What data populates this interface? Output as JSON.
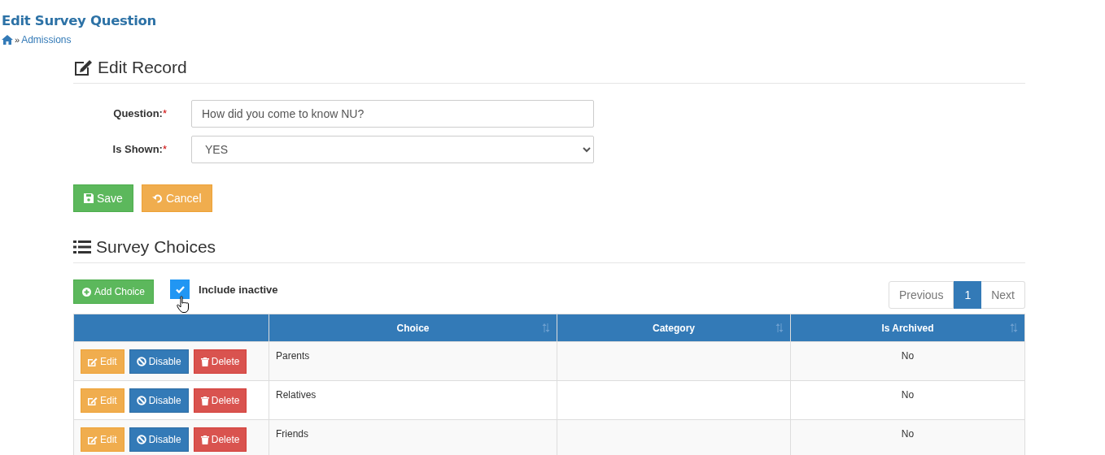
{
  "page": {
    "title": "Edit Survey Question"
  },
  "breadcrumb": {
    "separator": "»",
    "link": "Admissions"
  },
  "edit_record": {
    "heading": "Edit Record",
    "fields": [
      {
        "label": "Question:",
        "required_mark": "*",
        "kind": "text",
        "value": "How did you come to know NU?"
      },
      {
        "label": "Is Shown:",
        "required_mark": "*",
        "kind": "select",
        "value": "YES"
      }
    ],
    "buttons": [
      {
        "label": "Save",
        "kind": "save"
      },
      {
        "label": "Cancel",
        "kind": "cancel"
      }
    ]
  },
  "survey_choices": {
    "heading": "Survey Choices",
    "add_button": "Add Choice",
    "include_inactive": {
      "label": "Include inactive",
      "checked": true
    },
    "pagination": {
      "previous": "Previous",
      "pages": [
        {
          "label": "1",
          "selected": true
        }
      ],
      "next": "Next"
    },
    "table": {
      "columns": [
        {
          "label": "Choice",
          "sortable": true
        },
        {
          "label": "Category",
          "sortable": true
        },
        {
          "label": "Is Archived",
          "sortable": true
        }
      ],
      "rows": [
        {
          "actions": [
            {
              "label": "Edit",
              "kind": "edit"
            },
            {
              "label": "Disable",
              "kind": "disable"
            },
            {
              "label": "Delete",
              "kind": "delete"
            }
          ],
          "choice": "Parents",
          "is_archived": "No"
        },
        {
          "actions": [
            {
              "label": "Edit",
              "kind": "edit"
            },
            {
              "label": "Disable",
              "kind": "disable"
            },
            {
              "label": "Delete",
              "kind": "delete"
            }
          ],
          "choice": "Relatives",
          "is_archived": "No"
        },
        {
          "actions": [
            {
              "label": "Edit",
              "kind": "edit"
            },
            {
              "label": "Disable",
              "kind": "disable"
            },
            {
              "label": "Delete",
              "kind": "delete"
            }
          ],
          "choice": "Friends",
          "is_archived": "No"
        }
      ]
    }
  }
}
